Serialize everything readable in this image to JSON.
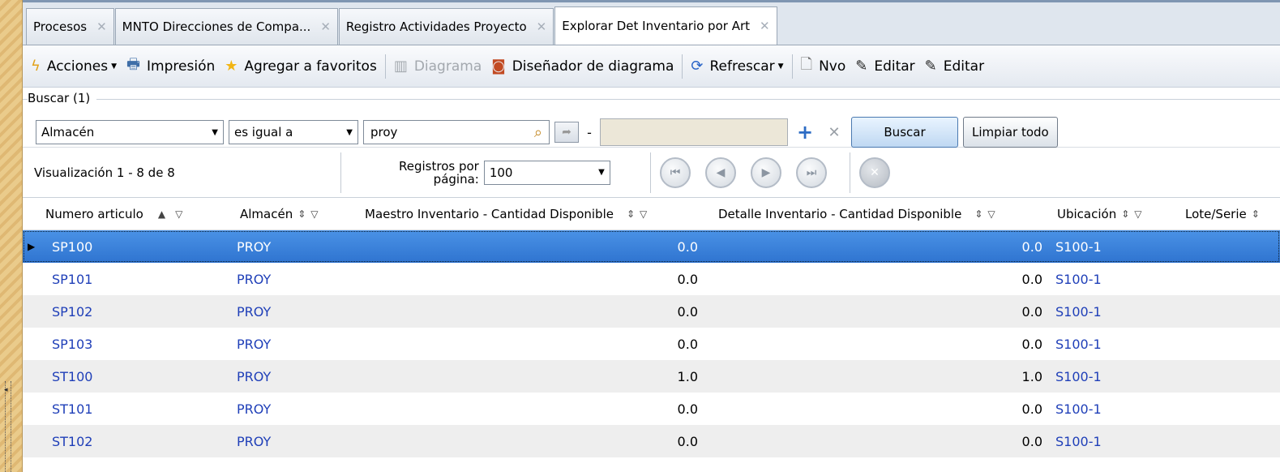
{
  "tabs": [
    {
      "label": "Procesos",
      "active": false
    },
    {
      "label": "MNTO Direcciones de Compa...",
      "active": false
    },
    {
      "label": "Registro Actividades Proyecto",
      "active": false
    },
    {
      "label": "Explorar Det Inventario por Art",
      "active": true
    }
  ],
  "toolbar": {
    "acciones": "Acciones",
    "impresion": "Impresión",
    "favoritos": "Agregar a favoritos",
    "diagrama": "Diagrama",
    "disenador": "Diseñador de diagrama",
    "refrescar": "Refrescar",
    "nuevo": "Nvo",
    "editar1": "Editar",
    "editar2": "Editar"
  },
  "search": {
    "title": "Buscar (1)",
    "field": "Almacén",
    "operator": "es igual a",
    "value": "proy",
    "dash": "-",
    "buscar": "Buscar",
    "limpiar": "Limpiar todo"
  },
  "pager": {
    "visualizacion": "Visualización  1 - 8  de  8",
    "registros_label_1": "Registros por",
    "registros_label_2": "página:",
    "per_page": "100"
  },
  "grid": {
    "columns": [
      "Numero articulo",
      "Almacén",
      "Maestro Inventario - Cantidad Disponible",
      "Detalle Inventario - Cantidad Disponible",
      "Ubicación",
      "Lote/Serie"
    ],
    "rows": [
      {
        "articulo": "SP100",
        "almacen": "PROY",
        "maestro": "0.0",
        "detalle": "0.0",
        "ubicacion": "S100-1"
      },
      {
        "articulo": "SP101",
        "almacen": "PROY",
        "maestro": "0.0",
        "detalle": "0.0",
        "ubicacion": "S100-1"
      },
      {
        "articulo": "SP102",
        "almacen": "PROY",
        "maestro": "0.0",
        "detalle": "0.0",
        "ubicacion": "S100-1"
      },
      {
        "articulo": "SP103",
        "almacen": "PROY",
        "maestro": "0.0",
        "detalle": "0.0",
        "ubicacion": "S100-1"
      },
      {
        "articulo": "ST100",
        "almacen": "PROY",
        "maestro": "1.0",
        "detalle": "1.0",
        "ubicacion": "S100-1"
      },
      {
        "articulo": "ST101",
        "almacen": "PROY",
        "maestro": "0.0",
        "detalle": "0.0",
        "ubicacion": "S100-1"
      },
      {
        "articulo": "ST102",
        "almacen": "PROY",
        "maestro": "0.0",
        "detalle": "0.0",
        "ubicacion": "S100-1"
      }
    ]
  }
}
